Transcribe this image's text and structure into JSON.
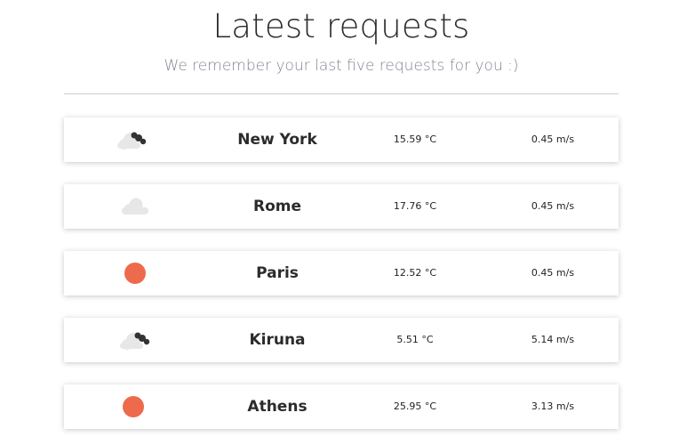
{
  "header": {
    "title": "Latest requests",
    "subtitle": "We remember your last five requests for you :)"
  },
  "colors": {
    "sun": "#ee6a4c",
    "cloud": "#e7e7e7",
    "dark_cloud": "#333333"
  },
  "requests": [
    {
      "icon": "cloud-dark-icon",
      "city": "New York",
      "temperature": "15.59 °C",
      "wind": "0.45 m/s"
    },
    {
      "icon": "cloud-icon",
      "city": "Rome",
      "temperature": "17.76 °C",
      "wind": "0.45 m/s"
    },
    {
      "icon": "sun-icon",
      "city": "Paris",
      "temperature": "12.52 °C",
      "wind": "0.45 m/s"
    },
    {
      "icon": "cloud-dark-icon",
      "city": "Kiruna",
      "temperature": "5.51 °C",
      "wind": "5.14 m/s"
    },
    {
      "icon": "sun-icon",
      "city": "Athens",
      "temperature": "25.95 °C",
      "wind": "3.13 m/s"
    }
  ]
}
